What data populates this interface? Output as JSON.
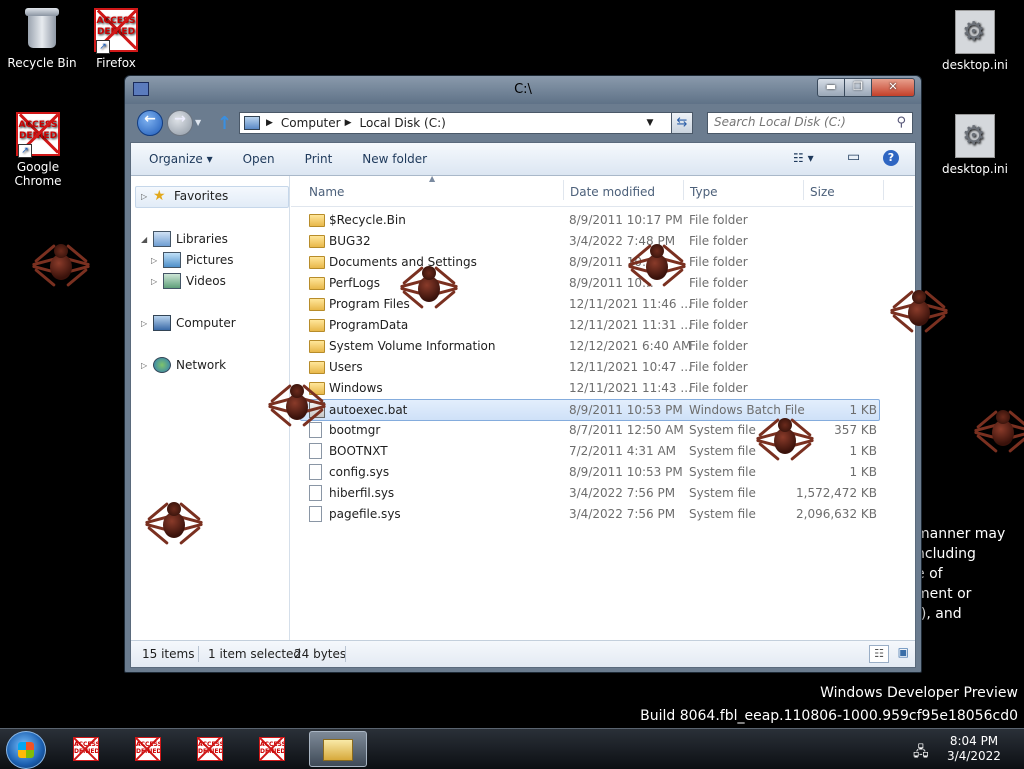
{
  "desktop": {
    "icons": [
      {
        "label": "Recycle Bin"
      },
      {
        "label": "Firefox",
        "badge_top": "ACCESS",
        "badge_bottom": "DENIED"
      },
      {
        "label_line1": "Google",
        "label_line2": "Chrome",
        "badge_top": "ACCESS",
        "badge_bottom": "DENIED"
      },
      {
        "label": "desktop.ini"
      },
      {
        "label": "desktop.ini"
      }
    ],
    "behind_text": [
      "manner may",
      "ncluding",
      "e of",
      "ment or",
      "f), and"
    ],
    "watermark": {
      "line1": "Windows Developer Preview",
      "line2": "Build 8064.fbl_eeap.110806-1000.959cf95e18056cd0"
    }
  },
  "window": {
    "title": "C:\\",
    "controls": {
      "minimize": "▬",
      "maximize": "❐",
      "close": "✕"
    },
    "breadcrumb": [
      "Computer",
      "Local Disk (C:)"
    ],
    "search_placeholder": "Search Local Disk (C:)",
    "toolbar": {
      "organize": "Organize ▾",
      "open": "Open",
      "print": "Print",
      "new_folder": "New folder",
      "views_icon": "☷ ▾",
      "preview_icon": "▭",
      "help_icon": "?"
    },
    "nav": {
      "favorites": "Favorites",
      "libraries": "Libraries",
      "pictures": "Pictures",
      "videos": "Videos",
      "computer": "Computer",
      "network": "Network"
    },
    "columns": {
      "name": "Name",
      "date": "Date modified",
      "type": "Type",
      "size": "Size"
    },
    "files": [
      {
        "name": "$Recycle.Bin",
        "date": "8/9/2011 10:17 PM",
        "type": "File folder",
        "size": "",
        "icon": "folder"
      },
      {
        "name": "BUG32",
        "date": "3/4/2022 7:48 PM",
        "type": "File folder",
        "size": "",
        "icon": "folder"
      },
      {
        "name": "Documents and Settings",
        "date": "8/9/2011 10:..",
        "type": "File folder",
        "size": "",
        "icon": "folder"
      },
      {
        "name": "PerfLogs",
        "date": "8/9/2011 10:..",
        "type": "File folder",
        "size": "",
        "icon": "folder"
      },
      {
        "name": "Program Files",
        "date": "12/11/2021 11:46 ...",
        "type": "File folder",
        "size": "",
        "icon": "folder"
      },
      {
        "name": "ProgramData",
        "date": "12/11/2021 11:31 ...",
        "type": "File folder",
        "size": "",
        "icon": "folder"
      },
      {
        "name": "System Volume Information",
        "date": "12/12/2021 6:40 AM",
        "type": "File folder",
        "size": "",
        "icon": "folder"
      },
      {
        "name": "Users",
        "date": "12/11/2021 10:47 ...",
        "type": "File folder",
        "size": "",
        "icon": "folder"
      },
      {
        "name": "Windows",
        "date": "12/11/2021 11:43 ...",
        "type": "File folder",
        "size": "",
        "icon": "folder"
      },
      {
        "name": "autoexec.bat",
        "date": "8/9/2011 10:53 PM",
        "type": "Windows Batch File",
        "size": "1 KB",
        "icon": "bat",
        "selected": true
      },
      {
        "name": "bootmgr",
        "date": "8/7/2011 12:50 AM",
        "type": "System file",
        "size": "357 KB",
        "icon": "file"
      },
      {
        "name": "BOOTNXT",
        "date": "7/2/2011 4:31 AM",
        "type": "System file",
        "size": "1 KB",
        "icon": "file"
      },
      {
        "name": "config.sys",
        "date": "8/9/2011 10:53 PM",
        "type": "System file",
        "size": "1 KB",
        "icon": "file"
      },
      {
        "name": "hiberfil.sys",
        "date": "3/4/2022 7:56 PM",
        "type": "System file",
        "size": "1,572,472 KB",
        "icon": "file"
      },
      {
        "name": "pagefile.sys",
        "date": "3/4/2022 7:56 PM",
        "type": "System file",
        "size": "2,096,632 KB",
        "icon": "file"
      }
    ],
    "status": {
      "items": "15 items",
      "selected": "1 item selected",
      "bytes": "24 bytes"
    }
  },
  "taskbar": {
    "items": [
      {
        "badge_top": "ACCESS",
        "badge_bottom": "DENIED"
      },
      {
        "badge_top": "ACCESS",
        "badge_bottom": "DENIED"
      },
      {
        "badge_top": "ACCESS",
        "badge_bottom": "DENIED"
      },
      {
        "badge_top": "ACCESS",
        "badge_bottom": "DENIED"
      }
    ],
    "clock_time": "8:04 PM",
    "clock_date": "3/4/2022"
  }
}
